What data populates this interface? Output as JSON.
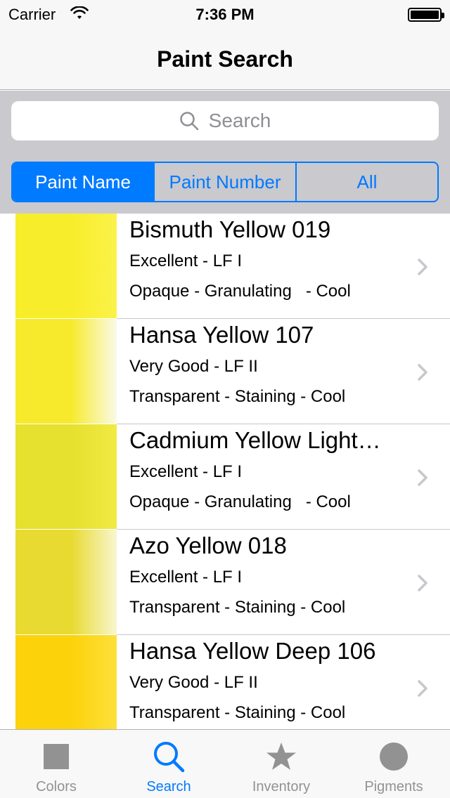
{
  "status_bar": {
    "carrier": "Carrier",
    "time": "7:36 PM"
  },
  "nav": {
    "title": "Paint Search"
  },
  "search": {
    "placeholder": "Search"
  },
  "segments": [
    {
      "label": "Paint Name",
      "selected": true
    },
    {
      "label": "Paint Number",
      "selected": false
    },
    {
      "label": "All",
      "selected": false
    }
  ],
  "paints": [
    {
      "name": "Bismuth Yellow 019",
      "rating": "Excellent - LF I",
      "properties": "Opaque - Granulating   - Cool",
      "swatch_color": "#f8ed2a",
      "swatch_light": "#fbf24a"
    },
    {
      "name": "Hansa Yellow 107",
      "rating": "Very Good - LF II",
      "properties": "Transparent - Staining - Cool",
      "swatch_color": "#f7ea2c",
      "swatch_light": "#fafae8"
    },
    {
      "name": "Cadmium Yellow Light…",
      "rating": "Excellent - LF I",
      "properties": "Opaque - Granulating   - Cool",
      "swatch_color": "#e6e02e",
      "swatch_light": "#f0ea44"
    },
    {
      "name": "Azo Yellow 018",
      "rating": "Excellent - LF I",
      "properties": "Transparent - Staining - Cool",
      "swatch_color": "#e8da30",
      "swatch_light": "#f8f6d0"
    },
    {
      "name": "Hansa Yellow Deep  106",
      "rating": "Very Good - LF II",
      "properties": "Transparent - Staining - Cool",
      "swatch_color": "#fcd20a",
      "swatch_light": "#fde03a"
    }
  ],
  "tabs": [
    {
      "label": "Colors",
      "icon": "square-icon",
      "active": false
    },
    {
      "label": "Search",
      "icon": "search-icon",
      "active": true
    },
    {
      "label": "Inventory",
      "icon": "star-icon",
      "active": false
    },
    {
      "label": "Pigments",
      "icon": "circle-icon",
      "active": false
    }
  ],
  "colors": {
    "accent": "#007aff",
    "inactive_tab": "#929292",
    "search_area_bg": "#c9c9ce"
  }
}
